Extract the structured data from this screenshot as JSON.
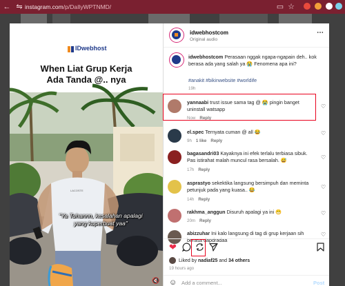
{
  "browser": {
    "url_host": "instagram.com",
    "url_path": "/p/DaIlyWPTNMD/",
    "extension_colors": [
      "#e84a3c",
      "#f3a13a",
      "#ffffff",
      "#7bd1e8"
    ]
  },
  "media": {
    "brand": "IDwebhost",
    "headline_line1": "When Liat Grup Kerja",
    "headline_line2": "Ada Tanda @.. nya",
    "subtitle_line1": "\"Ya Tuhannn, kesalahan apalagi",
    "subtitle_line2": "yang kuperbuat yaa\"",
    "shirt_text": "LACOSTE"
  },
  "header": {
    "username": "idwebhostcom",
    "audio": "Original audio",
    "more_icon": "more-horizontal-icon"
  },
  "caption": {
    "username": "idwebhostcom",
    "text": "Perasaan nggak ngapa-ngapain deh.. kok berasa ada yang salah ya 😭 Fenomena apa ini?",
    "tags": "#anakit #bikinwebsite #worldife",
    "time": "19h"
  },
  "comments": [
    {
      "username": "yannaabi",
      "text": "trust issue sama tag @ 😭 pingin banget uninstall watsapp",
      "time": "Now",
      "likes": "",
      "reply": "Reply",
      "avatar_color": "#b07a6a"
    },
    {
      "username": "el.spec",
      "text": "Ternyata cuman @ all 😂",
      "time": "9h",
      "likes": "1 like",
      "reply": "Reply",
      "avatar_color": "#2a3a4a"
    },
    {
      "username": "bagasandri03",
      "text": "Kayaknya ini efek terlalu terbiasa sibuk. Pas istirahat malah muncul rasa bersalah. 😅",
      "time": "17h",
      "likes": "",
      "reply": "Reply",
      "avatar_color": "#8a2020"
    },
    {
      "username": "asprastyo",
      "text": "sekektika langsung bersimpuh dan meminta petunjuk pada yang kuasa.. 😂",
      "time": "14h",
      "likes": "",
      "reply": "Reply",
      "avatar_color": "#e3c24a"
    },
    {
      "username": "rakhma_anggun",
      "text": "Disuruh apalagi ya ini 😁",
      "time": "20m",
      "likes": "",
      "reply": "Reply",
      "avatar_color": "#c07070"
    },
    {
      "username": "abizzuhar",
      "text": "Ini kalo langsung di tag di grup kerjaan sih berasa dapdradaa",
      "time": "",
      "likes": "",
      "reply": "",
      "avatar_color": "#6a5a50"
    }
  ],
  "actions": {
    "likes_prefix": "Liked by",
    "liked_by": "nadiaf25",
    "and": "and",
    "others": "34 others",
    "time": "19 hours ago"
  },
  "composer": {
    "placeholder": "Add a comment...",
    "post": "Post"
  }
}
